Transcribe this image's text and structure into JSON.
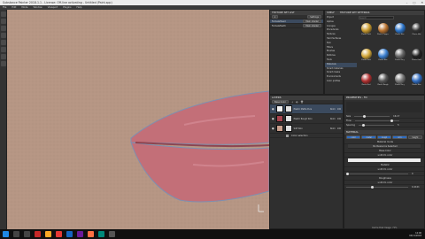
{
  "window": {
    "title": "Substance Painter 2018.1.1 - License: Off-line activating - Untitled (Paint.spp)"
  },
  "menu": [
    "File",
    "Edit",
    "Mode",
    "Window",
    "Viewport",
    "Plugins",
    "Help"
  ],
  "texture_set_list": {
    "title": "TEXTURE SET LIST",
    "settings_label": "Settings",
    "rows": [
      {
        "name": "FemaleHead",
        "shader": "Main shader"
      },
      {
        "name": "FemaleTeeth",
        "shader": "Main shader"
      }
    ]
  },
  "shelf": {
    "title": "SHELF",
    "tab2": "TEXTURE SET SETTINGS",
    "search_placeholder": "Search",
    "categories": [
      "Project",
      "Alphas",
      "Grunges",
      "Procedurals",
      "Textures",
      "Hard Surfaces",
      "Skin",
      "Filters",
      "Brushes",
      "Particles",
      "Tools",
      "Materials",
      "Smart materials",
      "Smart masks",
      "Environments",
      "Color profiles"
    ],
    "materials": [
      "Plastic Gold",
      "Plastic Copper",
      "Plastic Blue",
      "Plastic Mat",
      "Plastic Gold",
      "Plastic Blue",
      "Plastic Grey",
      "Plastic Dark",
      "Plastic Red",
      "Plastic Rough",
      "Plastic Grey",
      "Plastic Blue"
    ]
  },
  "layers": {
    "title": "LAYERS",
    "blend": "Base Color",
    "items": [
      {
        "name": "Plastic Matte Pure",
        "blend": "Norm",
        "opacity": "100"
      },
      {
        "name": "Plastic Rough Skin",
        "blend": "Norm",
        "opacity": "100"
      },
      {
        "name": "Soft Skin",
        "blend": "Norm",
        "opacity": "100"
      }
    ],
    "sub_item": "Color selection"
  },
  "properties": {
    "title": "PROPERTIES - Fill",
    "size_label": "Size",
    "size_value": "16.17",
    "flow_label": "Flow",
    "stroke_label": "Stroke",
    "spacing_label": "Spacing",
    "spacing_value": "5",
    "material_label": "MATERIAL",
    "channels": [
      "color",
      "metal",
      "rough",
      "nrm",
      "height"
    ],
    "material_mode": "Material mode",
    "no_resource": "No Resource Selected",
    "base_color": "Base Color",
    "uniform_color": "uniform color",
    "metallic": "Metallic",
    "metallic_sub": "uniform color",
    "metallic_value": "0",
    "roughness": "Roughness",
    "roughness_sub": "uniform color",
    "roughness_value": "0.4101"
  },
  "statusbar": {
    "text": "Cache Disk Usage: 71%"
  },
  "clock": {
    "time": "12:00",
    "date": "04/11/2018"
  },
  "colors": {
    "skin": "#b69684",
    "lip": "#c36f78",
    "accent": "#2d6cc2"
  }
}
